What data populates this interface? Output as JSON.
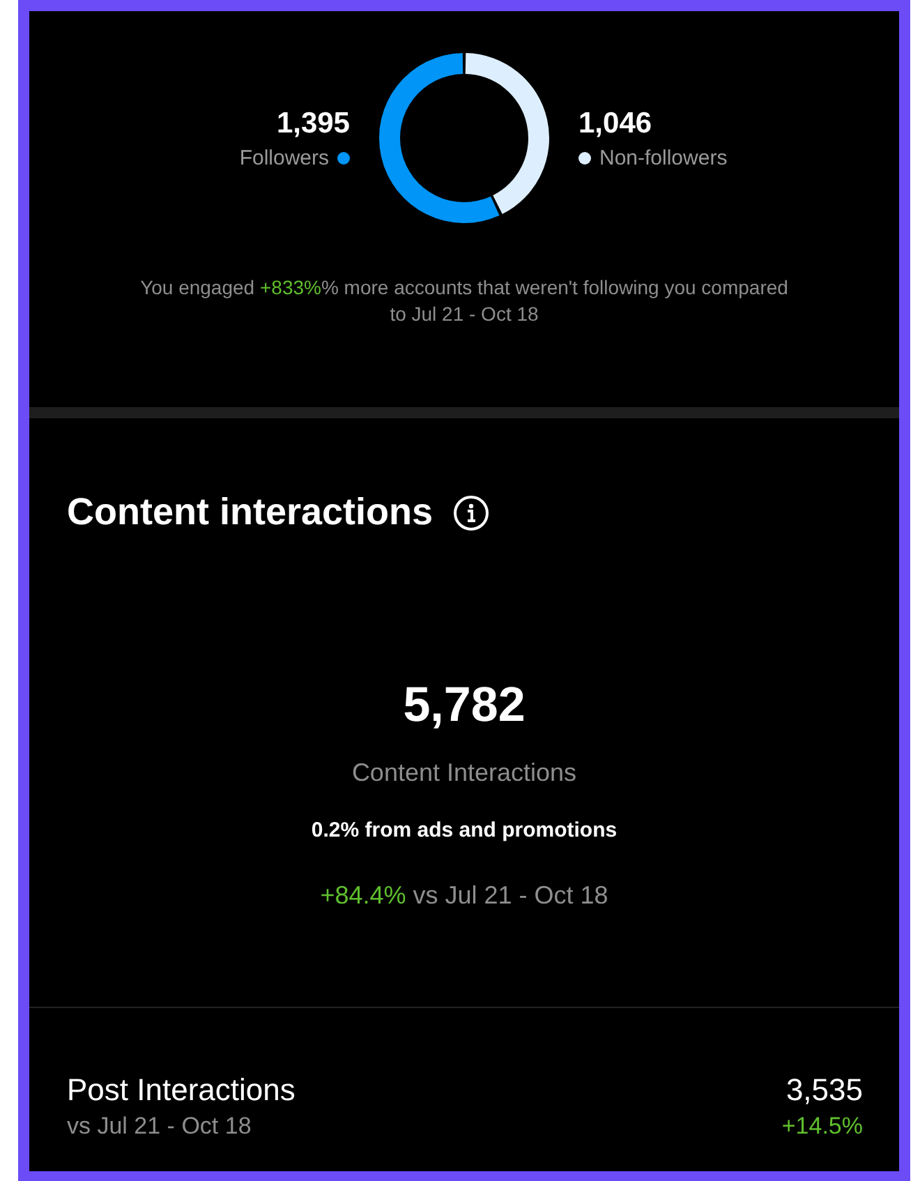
{
  "audience": {
    "legend": [
      {
        "count": "1,395",
        "color": "#0095f6"
      },
      {
        "count": "1,046",
        "color": "#ddeefe"
      }
    ],
    "chart_data": {
      "type": "donut",
      "categories": [
        "Followers",
        "Non-followers"
      ],
      "values": [
        57.1,
        42.9
      ]
    },
    "note": {
      "before": "You engaged ",
      "highlight": "+833%",
      "after": "% more accounts that weren't following you compared to Jul 21 - Oct 18"
    }
  },
  "content_interactions": {
    "title": "Content interactions",
    "total": "5,782",
    "total_label": "Content Interactions",
    "ads_share": "0.2% from ads and promotions",
    "change": {
      "highlight": "+84.4%",
      "rest": " vs Jul 21 - Oct 18"
    }
  },
  "breakdown": [
    {
      "title": "Post Interactions",
      "subtitle": "vs Jul 21 - Oct 18",
      "value": "3,535",
      "change": "+14.5%"
    }
  ]
}
